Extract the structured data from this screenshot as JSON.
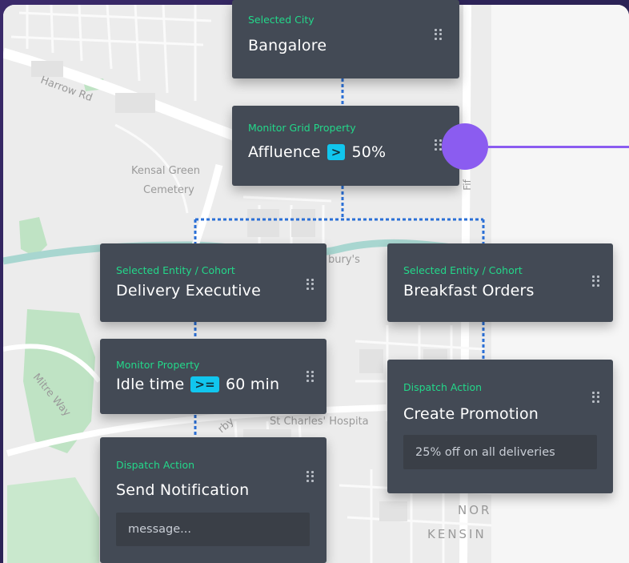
{
  "map": {
    "labels": [
      "Harrow Rd",
      "Kensal Green",
      "Cemetery",
      "bury's",
      "Mitre Way",
      "rby",
      "St Charles' Hospita",
      "NOR",
      "KENSIN",
      "Fif"
    ]
  },
  "nodes": {
    "city": {
      "tag": "Selected City",
      "title": "Bangalore"
    },
    "grid": {
      "tag": "Monitor Grid Property",
      "property": "Affluence",
      "operator": ">",
      "value": "50%"
    },
    "entity_left": {
      "tag": "Selected Entity / Cohort",
      "title": "Delivery Executive"
    },
    "entity_right": {
      "tag": "Selected Entity / Cohort",
      "title": "Breakfast Orders"
    },
    "monitor": {
      "tag": "Monitor Property",
      "property": "Idle time",
      "operator": ">=",
      "value": "60 min"
    },
    "dispatch_left": {
      "tag": "Dispatch Action",
      "title": "Send Notification",
      "placeholder": "message..."
    },
    "dispatch_right": {
      "tag": "Dispatch Action",
      "title": "Create Promotion",
      "value": "25% off on all deliveries"
    }
  },
  "colors": {
    "card_bg": "#434a55",
    "tag_green": "#23d88a",
    "operator_cyan": "#11c6ee",
    "connector_blue": "#2a6fd6",
    "accent_purple": "#8b5cf0",
    "background": "#2d2358"
  }
}
